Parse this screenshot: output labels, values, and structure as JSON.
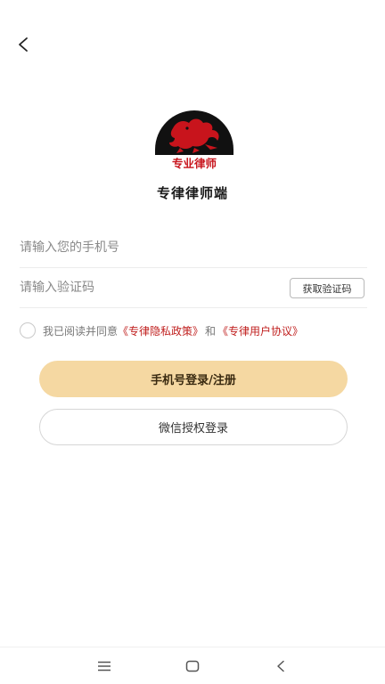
{
  "header": {
    "back_icon": "chevron-left-icon"
  },
  "brand": {
    "logo_caption": "专业律师",
    "app_name": "专律律师端",
    "logo_color": "#c8141c",
    "logo_bg": "#111111"
  },
  "form": {
    "phone_placeholder": "请输入您的手机号",
    "code_placeholder": "请输入验证码",
    "get_code_label": "获取验证码"
  },
  "agreement": {
    "prefix": "我已阅读并同意",
    "privacy_link": "《专律隐私政策》",
    "conjunction": "和",
    "user_link": "《专律用户协议》",
    "link_color": "#c0201f"
  },
  "actions": {
    "phone_login_label": "手机号登录/注册",
    "wechat_login_label": "微信授权登录",
    "primary_color": "#f5d8a2"
  },
  "nav": {
    "menu_icon": "menu-icon",
    "home_icon": "home-icon",
    "back_icon": "back-icon"
  }
}
